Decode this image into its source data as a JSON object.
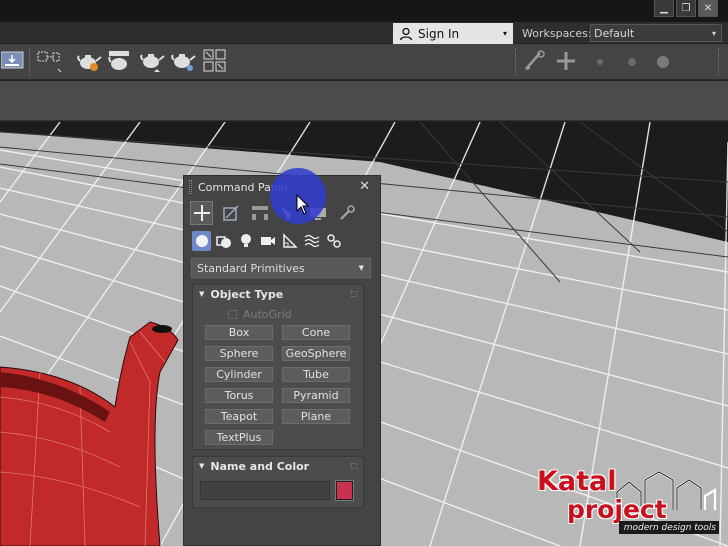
{
  "window": {
    "minimize_glyph": "▁",
    "restore_glyph": "❐",
    "close_glyph": "✕"
  },
  "account": {
    "sign_in_label": "Sign In",
    "caret": "▾"
  },
  "workspace": {
    "label": "Workspaces:",
    "value": "Default",
    "caret": "▾"
  },
  "command_panel": {
    "title": "Command Panel",
    "close_glyph": "✕",
    "tabs": [
      "create-icon",
      "modify-icon",
      "hierarchy-icon",
      "motion-icon",
      "display-icon",
      "utilities-icon"
    ],
    "categories": [
      "geometry-icon",
      "shapes-icon",
      "lights-icon",
      "cameras-icon",
      "helpers-icon",
      "space-warps-icon",
      "systems-icon"
    ],
    "dropdown_value": "Standard Primitives",
    "dropdown_caret": "▼",
    "object_type": {
      "title": "Object Type",
      "autogrid_label": "AutoGrid",
      "buttons": [
        "Box",
        "Cone",
        "Sphere",
        "GeoSphere",
        "Cylinder",
        "Tube",
        "Torus",
        "Pyramid",
        "Teapot",
        "Plane",
        "TextPlus"
      ]
    },
    "name_and_color": {
      "title": "Name and Color",
      "swatch_color": "#c8324e"
    },
    "rollout_triangle": "▼"
  },
  "logo": {
    "line1": "Katal",
    "line2": "project",
    "tagline": "modern design tools",
    "color": "#c8101e"
  }
}
